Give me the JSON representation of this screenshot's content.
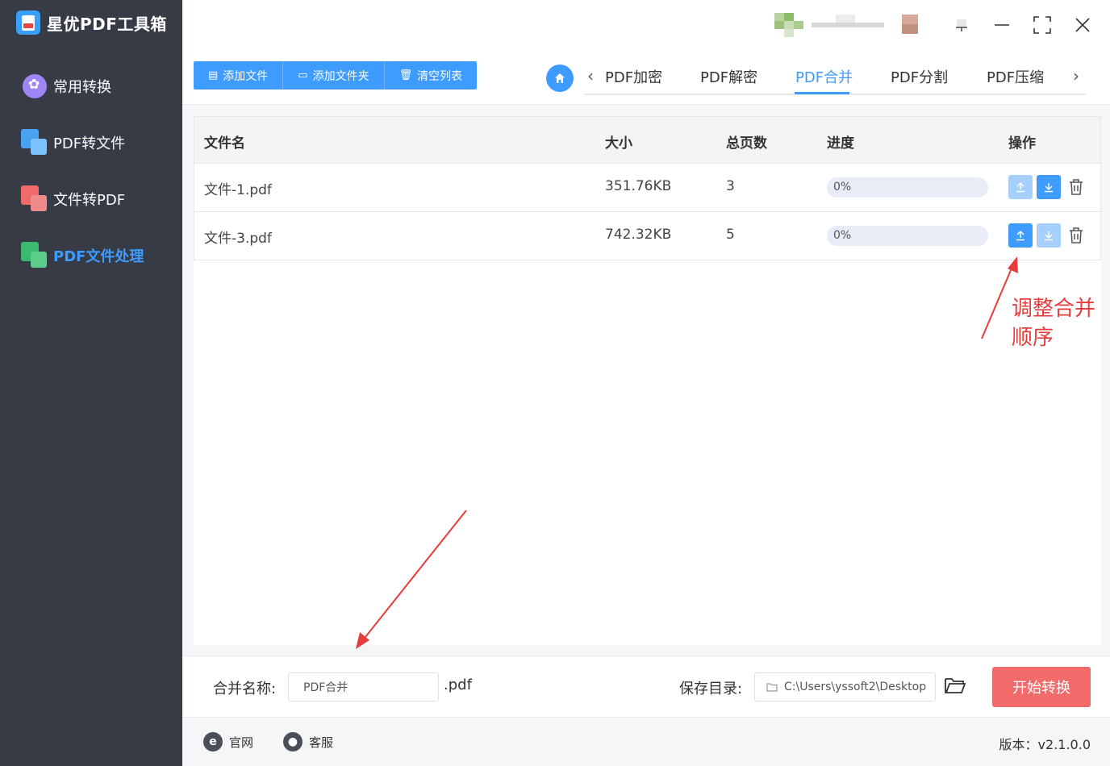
{
  "app": {
    "title": "星优PDF工具箱"
  },
  "sidebar": {
    "items": [
      {
        "label": "常用转换",
        "icon": "clover-icon",
        "active": false
      },
      {
        "label": "PDF转文件",
        "icon": "pdf-to-file-icon",
        "active": false
      },
      {
        "label": "文件转PDF",
        "icon": "file-to-pdf-icon",
        "active": false
      },
      {
        "label": "PDF文件处理",
        "icon": "pdf-process-icon",
        "active": true
      }
    ]
  },
  "window": {
    "controls": [
      "pin-icon",
      "minimize-icon",
      "maximize-icon",
      "close-icon"
    ]
  },
  "toolbar": {
    "add_file": "添加文件",
    "add_folder": "添加文件夹",
    "clear_list": "清空列表"
  },
  "tabs": {
    "items": [
      "PDF加密",
      "PDF解密",
      "PDF合并",
      "PDF分割",
      "PDF压缩"
    ],
    "active": "PDF合并"
  },
  "table": {
    "headers": [
      "文件名",
      "大小",
      "总页数",
      "进度",
      "操作"
    ],
    "rows": [
      {
        "name": "文件-1.pdf",
        "size": "351.76KB",
        "pages": "3",
        "progress_text": "0%",
        "progress": 0,
        "up_enabled": false,
        "down_enabled": true
      },
      {
        "name": "文件-3.pdf",
        "size": "742.32KB",
        "pages": "5",
        "progress_text": "0%",
        "progress": 0,
        "up_enabled": true,
        "down_enabled": false
      }
    ]
  },
  "annotation": {
    "line1": "调整合并",
    "line2": "顺序"
  },
  "bottom": {
    "merge_name_label": "合并名称:",
    "merge_name_value": "PDF合并",
    "extension": ".pdf",
    "save_dir_label": "保存目录:",
    "save_dir_value": "C:\\Users\\yssoft2\\Desktop",
    "start_button": "开始转换"
  },
  "footer": {
    "website": "官网",
    "support": "客服",
    "version": "版本：v2.1.0.0"
  },
  "colors": {
    "sidebar_bg": "#373b46",
    "accent": "#3e9bff",
    "start_button": "#f26b6b",
    "annotation": "#e53c3c"
  }
}
